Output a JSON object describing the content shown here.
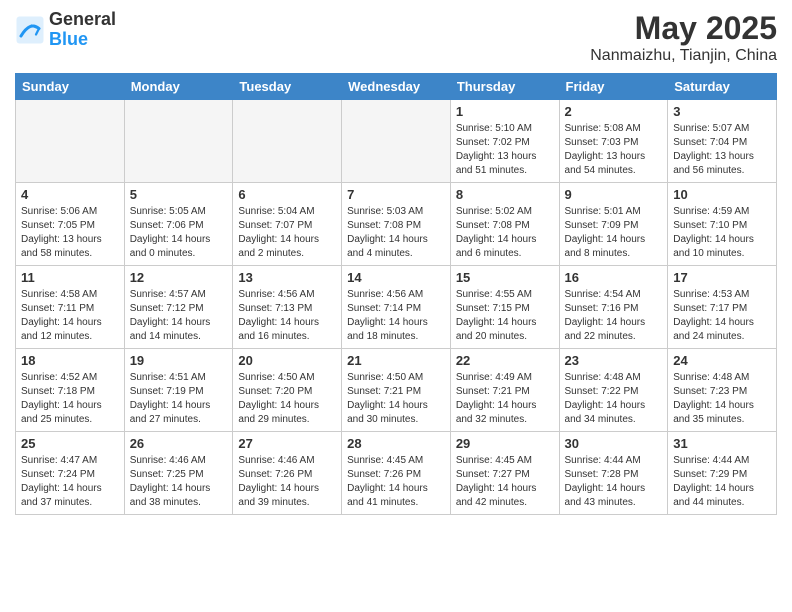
{
  "header": {
    "logo_line1": "General",
    "logo_line2": "Blue",
    "month_year": "May 2025",
    "location": "Nanmaizhu, Tianjin, China"
  },
  "weekdays": [
    "Sunday",
    "Monday",
    "Tuesday",
    "Wednesday",
    "Thursday",
    "Friday",
    "Saturday"
  ],
  "weeks": [
    [
      {
        "day": "",
        "info": ""
      },
      {
        "day": "",
        "info": ""
      },
      {
        "day": "",
        "info": ""
      },
      {
        "day": "",
        "info": ""
      },
      {
        "day": "1",
        "info": "Sunrise: 5:10 AM\nSunset: 7:02 PM\nDaylight: 13 hours\nand 51 minutes."
      },
      {
        "day": "2",
        "info": "Sunrise: 5:08 AM\nSunset: 7:03 PM\nDaylight: 13 hours\nand 54 minutes."
      },
      {
        "day": "3",
        "info": "Sunrise: 5:07 AM\nSunset: 7:04 PM\nDaylight: 13 hours\nand 56 minutes."
      }
    ],
    [
      {
        "day": "4",
        "info": "Sunrise: 5:06 AM\nSunset: 7:05 PM\nDaylight: 13 hours\nand 58 minutes."
      },
      {
        "day": "5",
        "info": "Sunrise: 5:05 AM\nSunset: 7:06 PM\nDaylight: 14 hours\nand 0 minutes."
      },
      {
        "day": "6",
        "info": "Sunrise: 5:04 AM\nSunset: 7:07 PM\nDaylight: 14 hours\nand 2 minutes."
      },
      {
        "day": "7",
        "info": "Sunrise: 5:03 AM\nSunset: 7:08 PM\nDaylight: 14 hours\nand 4 minutes."
      },
      {
        "day": "8",
        "info": "Sunrise: 5:02 AM\nSunset: 7:08 PM\nDaylight: 14 hours\nand 6 minutes."
      },
      {
        "day": "9",
        "info": "Sunrise: 5:01 AM\nSunset: 7:09 PM\nDaylight: 14 hours\nand 8 minutes."
      },
      {
        "day": "10",
        "info": "Sunrise: 4:59 AM\nSunset: 7:10 PM\nDaylight: 14 hours\nand 10 minutes."
      }
    ],
    [
      {
        "day": "11",
        "info": "Sunrise: 4:58 AM\nSunset: 7:11 PM\nDaylight: 14 hours\nand 12 minutes."
      },
      {
        "day": "12",
        "info": "Sunrise: 4:57 AM\nSunset: 7:12 PM\nDaylight: 14 hours\nand 14 minutes."
      },
      {
        "day": "13",
        "info": "Sunrise: 4:56 AM\nSunset: 7:13 PM\nDaylight: 14 hours\nand 16 minutes."
      },
      {
        "day": "14",
        "info": "Sunrise: 4:56 AM\nSunset: 7:14 PM\nDaylight: 14 hours\nand 18 minutes."
      },
      {
        "day": "15",
        "info": "Sunrise: 4:55 AM\nSunset: 7:15 PM\nDaylight: 14 hours\nand 20 minutes."
      },
      {
        "day": "16",
        "info": "Sunrise: 4:54 AM\nSunset: 7:16 PM\nDaylight: 14 hours\nand 22 minutes."
      },
      {
        "day": "17",
        "info": "Sunrise: 4:53 AM\nSunset: 7:17 PM\nDaylight: 14 hours\nand 24 minutes."
      }
    ],
    [
      {
        "day": "18",
        "info": "Sunrise: 4:52 AM\nSunset: 7:18 PM\nDaylight: 14 hours\nand 25 minutes."
      },
      {
        "day": "19",
        "info": "Sunrise: 4:51 AM\nSunset: 7:19 PM\nDaylight: 14 hours\nand 27 minutes."
      },
      {
        "day": "20",
        "info": "Sunrise: 4:50 AM\nSunset: 7:20 PM\nDaylight: 14 hours\nand 29 minutes."
      },
      {
        "day": "21",
        "info": "Sunrise: 4:50 AM\nSunset: 7:21 PM\nDaylight: 14 hours\nand 30 minutes."
      },
      {
        "day": "22",
        "info": "Sunrise: 4:49 AM\nSunset: 7:21 PM\nDaylight: 14 hours\nand 32 minutes."
      },
      {
        "day": "23",
        "info": "Sunrise: 4:48 AM\nSunset: 7:22 PM\nDaylight: 14 hours\nand 34 minutes."
      },
      {
        "day": "24",
        "info": "Sunrise: 4:48 AM\nSunset: 7:23 PM\nDaylight: 14 hours\nand 35 minutes."
      }
    ],
    [
      {
        "day": "25",
        "info": "Sunrise: 4:47 AM\nSunset: 7:24 PM\nDaylight: 14 hours\nand 37 minutes."
      },
      {
        "day": "26",
        "info": "Sunrise: 4:46 AM\nSunset: 7:25 PM\nDaylight: 14 hours\nand 38 minutes."
      },
      {
        "day": "27",
        "info": "Sunrise: 4:46 AM\nSunset: 7:26 PM\nDaylight: 14 hours\nand 39 minutes."
      },
      {
        "day": "28",
        "info": "Sunrise: 4:45 AM\nSunset: 7:26 PM\nDaylight: 14 hours\nand 41 minutes."
      },
      {
        "day": "29",
        "info": "Sunrise: 4:45 AM\nSunset: 7:27 PM\nDaylight: 14 hours\nand 42 minutes."
      },
      {
        "day": "30",
        "info": "Sunrise: 4:44 AM\nSunset: 7:28 PM\nDaylight: 14 hours\nand 43 minutes."
      },
      {
        "day": "31",
        "info": "Sunrise: 4:44 AM\nSunset: 7:29 PM\nDaylight: 14 hours\nand 44 minutes."
      }
    ]
  ]
}
